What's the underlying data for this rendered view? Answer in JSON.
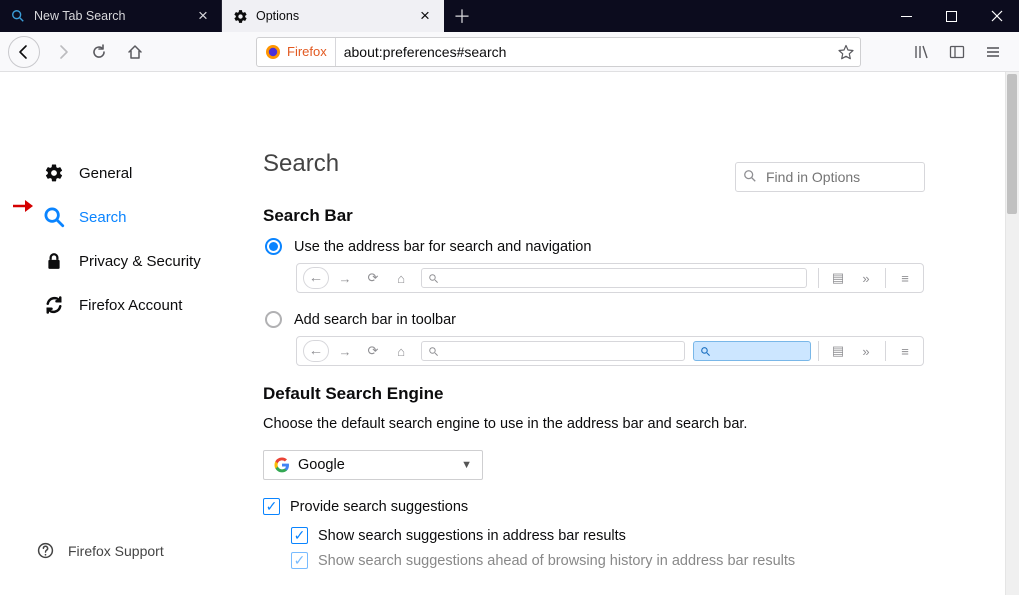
{
  "tabs": {
    "0": {
      "label": "New Tab Search"
    },
    "1": {
      "label": "Options"
    }
  },
  "nav": {
    "identity_label": "Firefox",
    "url": "about:preferences#search"
  },
  "find": {
    "placeholder": "Find in Options"
  },
  "sidebar": {
    "items": {
      "0": {
        "label": "General"
      },
      "1": {
        "label": "Search"
      },
      "2": {
        "label": "Privacy & Security"
      },
      "3": {
        "label": "Firefox Account"
      }
    },
    "support": "Firefox Support"
  },
  "page": {
    "title": "Search",
    "searchbar_heading": "Search Bar",
    "radio": {
      "0": "Use the address bar for search and navigation",
      "1": "Add search bar in toolbar"
    },
    "default_heading": "Default Search Engine",
    "default_desc": "Choose the default search engine to use in the address bar and search bar.",
    "engine": "Google",
    "suggest_main": "Provide search suggestions",
    "suggest_sub1": "Show search suggestions in address bar results",
    "suggest_sub2_cut": "Show search suggestions ahead of browsing history in address bar results"
  }
}
